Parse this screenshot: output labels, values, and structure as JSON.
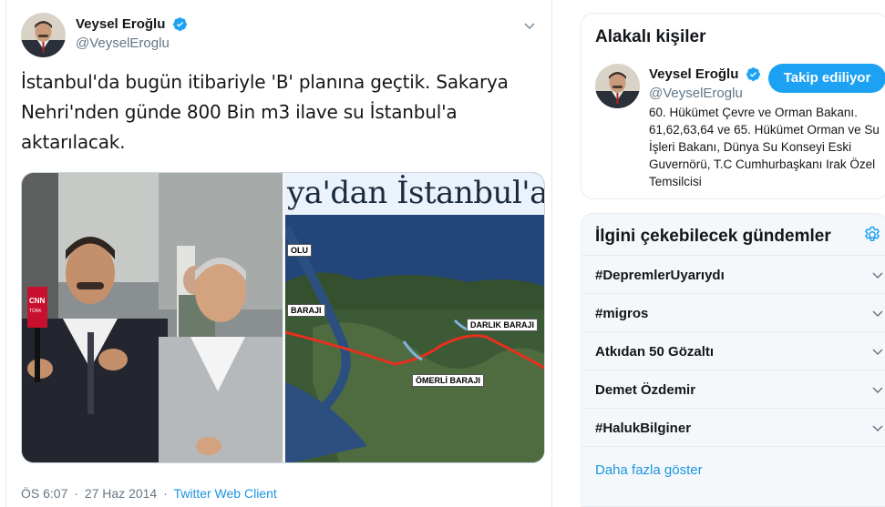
{
  "tweet": {
    "author_name": "Veysel Eroğlu",
    "author_handle": "@VeyselEroglu",
    "verified": true,
    "text": "İstanbul'da bugün itibariyle 'B' planına geçtik. Sakarya Nehri'nden günde 800 Bin m3 ilave su İstanbul'a aktarılacak.",
    "media": {
      "map_headline": "ya'dan İstanbul'a",
      "map_labels": [
        "OLU",
        "BARAJI",
        "DARLIK BARAJI",
        "ÖMERLİ BARAJI"
      ],
      "news_tag": "CNN TÜRK"
    },
    "time": "ÖS 6:07",
    "date": "27 Haz 2014",
    "separator": "·",
    "source": "Twitter Web Client"
  },
  "related": {
    "title": "Alakalı kişiler",
    "person": {
      "name": "Veysel Eroğlu",
      "handle": "@VeyselEroglu",
      "verified": true,
      "follow_label": "Takip ediliyor",
      "bio": "60. Hükümet Çevre ve Orman Bakanı. 61,62,63,64 ve 65. Hükümet Orman ve Su İşleri Bakanı, Dünya Su Konseyi Eski Guvernörü, T.C Cumhurbaşkanı Irak Özel Temsilcisi"
    }
  },
  "trends": {
    "title": "İlgini çekebilecek gündemler",
    "settings_icon": "gear-icon",
    "items": [
      {
        "label": "#DepremlerUyarıydı"
      },
      {
        "label": "#migros"
      },
      {
        "label": "Atkıdan 50 Gözaltı"
      },
      {
        "label": "Demet Özdemir"
      },
      {
        "label": "#HalukBilginer"
      }
    ],
    "show_more": "Daha fazla göster"
  },
  "colors": {
    "accent": "#1da1f2",
    "link": "#1b95e0",
    "muted": "#657786",
    "border": "#e6ecf0"
  }
}
